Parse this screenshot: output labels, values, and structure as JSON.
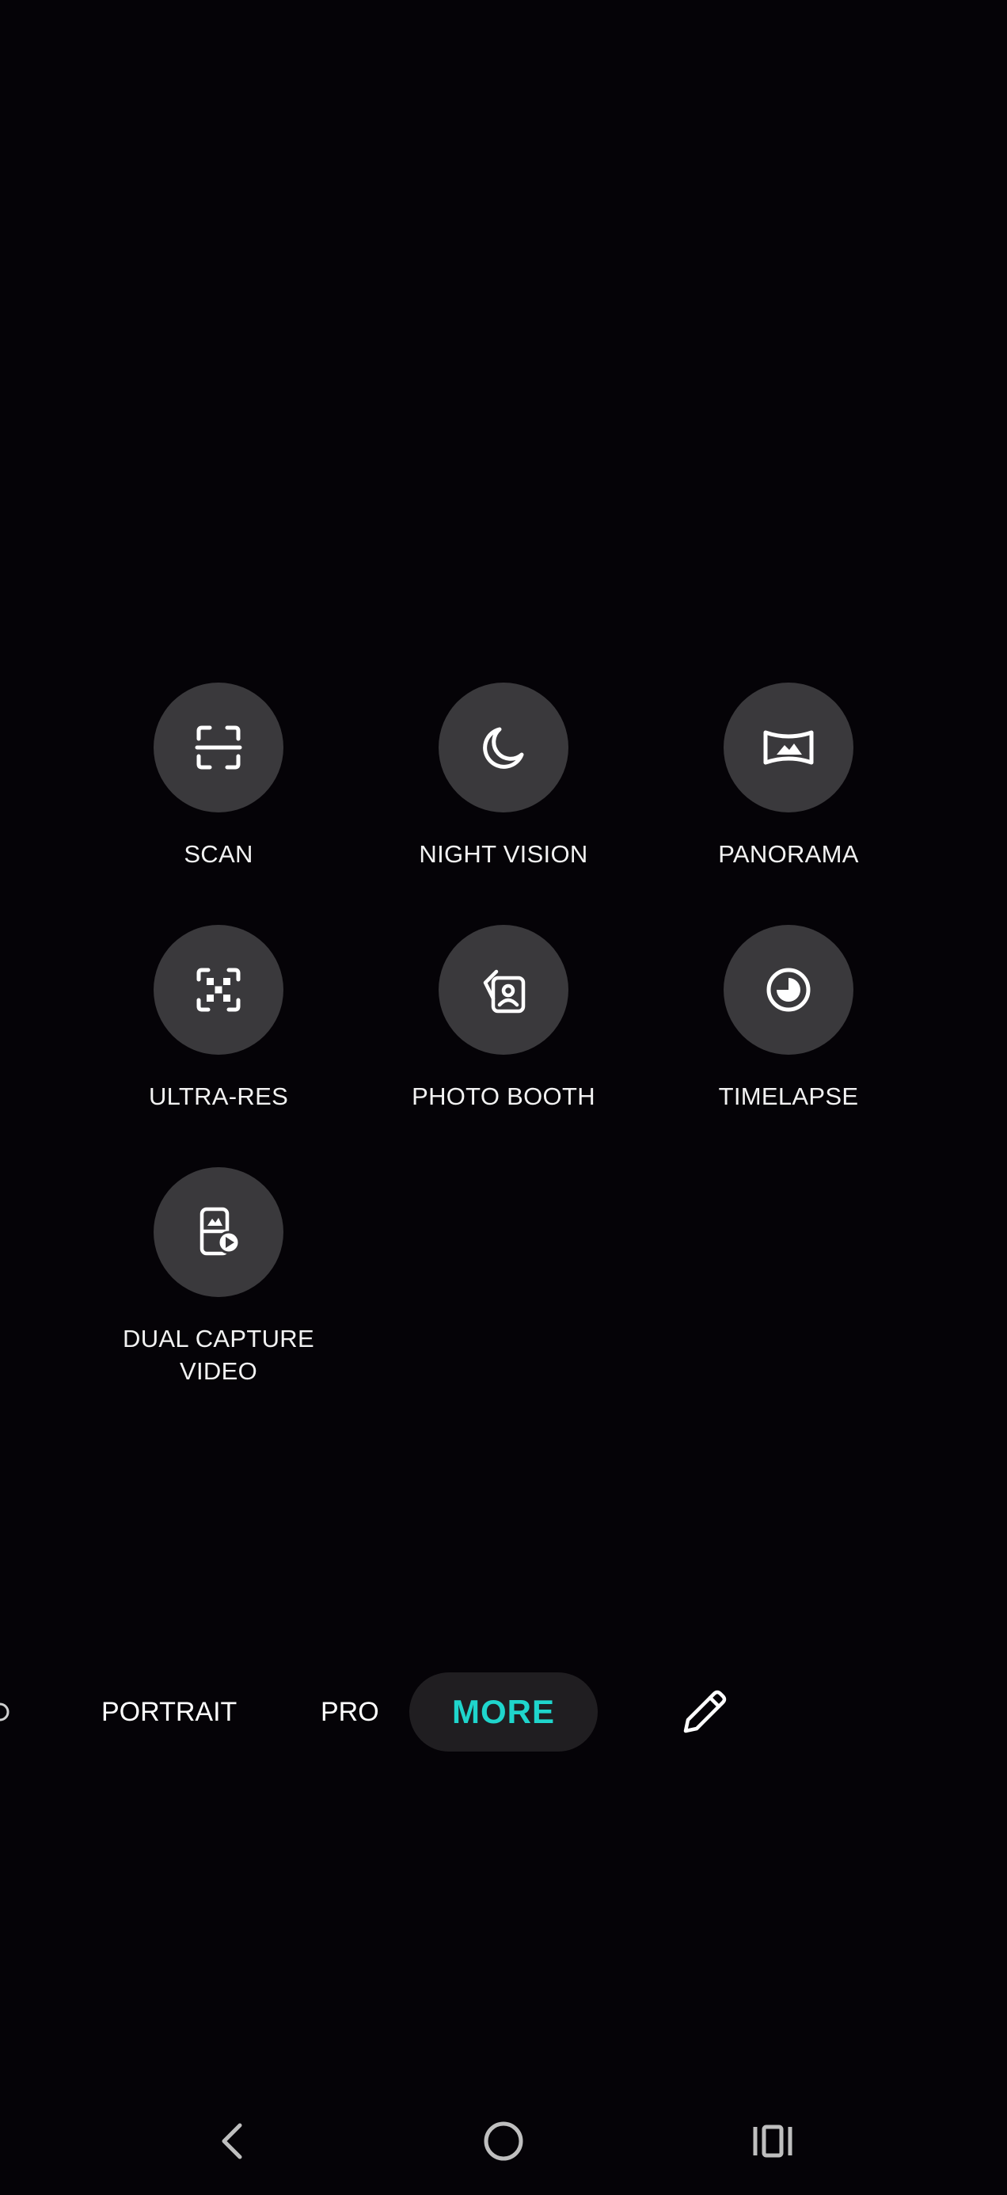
{
  "modes": [
    {
      "key": "scan",
      "label": "SCAN",
      "icon": "scan-icon"
    },
    {
      "key": "night-vision",
      "label": "NIGHT VISION",
      "icon": "moon-icon"
    },
    {
      "key": "panorama",
      "label": "PANORAMA",
      "icon": "panorama-icon"
    },
    {
      "key": "ultra-res",
      "label": "ULTRA-RES",
      "icon": "ultra-res-icon"
    },
    {
      "key": "photo-booth",
      "label": "PHOTO BOOTH",
      "icon": "photo-booth-icon"
    },
    {
      "key": "timelapse",
      "label": "TIMELAPSE",
      "icon": "timelapse-icon"
    },
    {
      "key": "dual-capture-video",
      "label_lines": [
        "DUAL CAPTURE",
        "VIDEO"
      ],
      "icon": "dual-capture-video-icon"
    }
  ],
  "mode_bar": {
    "portrait": "PORTRAIT",
    "pro": "PRO",
    "more": "MORE",
    "edit_icon": "pencil-icon",
    "active_color": "#1fd5cc"
  },
  "nav": {
    "back_icon": "back-icon",
    "home_icon": "home-icon",
    "recents_icon": "recents-icon"
  }
}
